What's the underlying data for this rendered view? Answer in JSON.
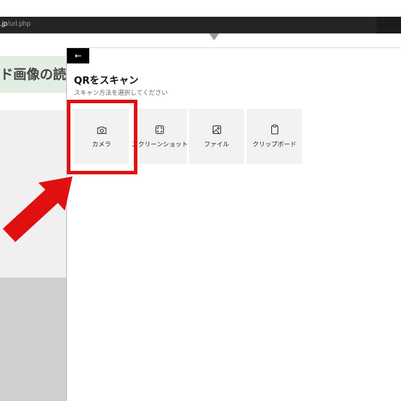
{
  "browser": {
    "url_host": ".jp",
    "url_path": "/url.php"
  },
  "webpage": {
    "heading": "ド画像の読"
  },
  "scan_panel": {
    "back_icon": "back-arrow-icon",
    "title": "QRをスキャン",
    "subtitle": "スキャン方法を選択してください",
    "options": [
      {
        "label": "カメラ",
        "icon": "camera-icon"
      },
      {
        "label": "スクリーンショット",
        "icon": "screenshot-icon"
      },
      {
        "label": "ファイル",
        "icon": "file-image-icon"
      },
      {
        "label": "クリップボード",
        "icon": "clipboard-icon"
      }
    ]
  },
  "annotation": {
    "highlight_color": "#e01010",
    "arrow_color": "#e01010"
  }
}
